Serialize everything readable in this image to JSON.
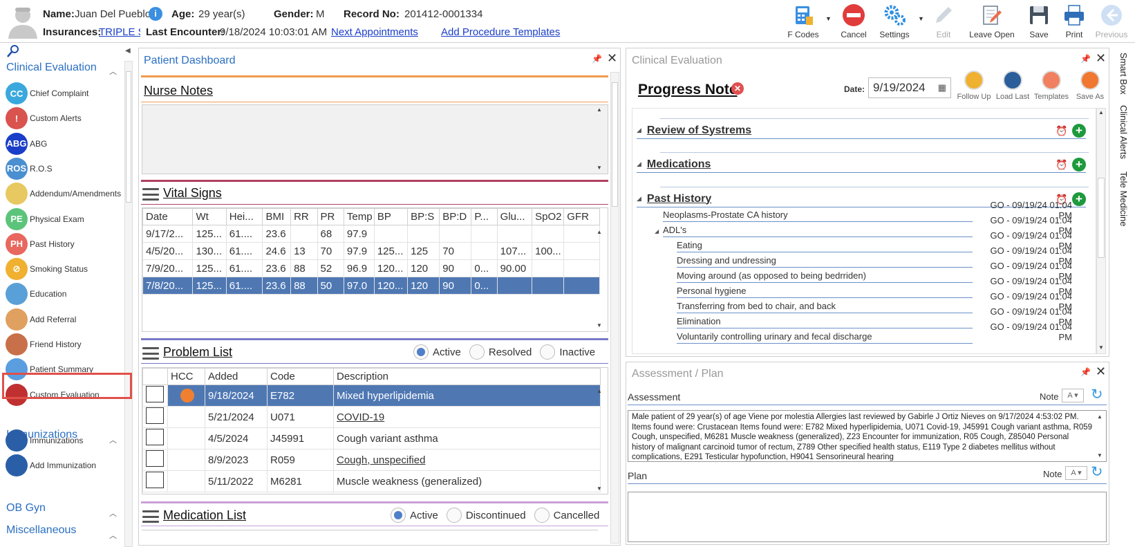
{
  "header": {
    "name_label": "Name:",
    "name_value": "Juan Del Pueblo",
    "age_label": "Age:",
    "age_value": "29 year(s)",
    "gender_label": "Gender:",
    "gender_value": "M",
    "record_label": "Record No:",
    "record_value": "201412-0001334",
    "insurances_label": "Insurances:",
    "insurances_value": "TRIPLE S",
    "last_encounter_label": "Last Encounter:",
    "last_encounter_value": "9/18/2024 10:03:01 AM",
    "next_appointments": "Next Appointments",
    "add_procedure_templates": "Add Procedure Templates"
  },
  "toolbar": {
    "fcodes": "F Codes",
    "cancel": "Cancel",
    "settings": "Settings",
    "edit": "Edit",
    "leave_open": "Leave Open",
    "save": "Save",
    "print": "Print",
    "previous": "Previous"
  },
  "nav": {
    "sections": {
      "clinical": "Clinical Evaluation",
      "immunizations": "Immunizations",
      "obgyn": "OB Gyn",
      "misc": "Miscellaneous"
    },
    "items": [
      {
        "label": "Chief Complaint",
        "badge": "CC",
        "color": "#3aa8dd"
      },
      {
        "label": "Custom Alerts",
        "badge": "!",
        "color": "#d9534f"
      },
      {
        "label": "ABG",
        "badge": "ABG",
        "color": "#1a3ec8"
      },
      {
        "label": "R.O.S",
        "badge": "ROS",
        "color": "#4a8fd0"
      },
      {
        "label": "Addendum/Amendments",
        "badge": "",
        "color": "#e8c860"
      },
      {
        "label": "Physical Exam",
        "badge": "PE",
        "color": "#5cc47a"
      },
      {
        "label": "Past History",
        "badge": "PH",
        "color": "#e8675f"
      },
      {
        "label": "Smoking Status",
        "badge": "⊘",
        "color": "#f0b030"
      },
      {
        "label": "Education",
        "badge": "",
        "color": "#5aa0d8"
      },
      {
        "label": "Add Referral",
        "badge": "",
        "color": "#e0a060"
      },
      {
        "label": "Friend History",
        "badge": "",
        "color": "#c8704a"
      },
      {
        "label": "Patient Summary",
        "badge": "",
        "color": "#5a9ee0"
      },
      {
        "label": "Custom Evaluation",
        "badge": "",
        "color": "#c03030"
      }
    ],
    "imm_items": [
      {
        "label": "Immunizations",
        "badge": "",
        "color": "#2a5fa8"
      },
      {
        "label": "Add Immunization",
        "badge": "",
        "color": "#2a5fa8"
      }
    ]
  },
  "dashboard": {
    "title": "Patient Dashboard",
    "nurse_notes": "Nurse Notes",
    "vital_signs": "Vital Signs",
    "vitals_columns": [
      "Date",
      "Wt",
      "Hei...",
      "BMI",
      "RR",
      "PR",
      "Temp",
      "BP",
      "BP:S",
      "BP:D",
      "P...",
      "Glu...",
      "SpO2",
      "GFR"
    ],
    "vitals_rows": [
      [
        "9/17/2...",
        "125...",
        "61....",
        "23.6",
        "",
        "68",
        "97.9",
        "",
        "",
        "",
        "",
        "",
        "",
        ""
      ],
      [
        "4/5/20...",
        "130...",
        "61....",
        "24.6",
        "13",
        "70",
        "97.9",
        "125...",
        "125",
        "70",
        "",
        "107...",
        "100...",
        ""
      ],
      [
        "7/9/20...",
        "125...",
        "61....",
        "23.6",
        "88",
        "52",
        "96.9",
        "120...",
        "120",
        "90",
        "0...",
        "90.00",
        "",
        ""
      ],
      [
        "7/8/20...",
        "125...",
        "61....",
        "23.6",
        "88",
        "50",
        "97.0",
        "120...",
        "120",
        "90",
        "0...",
        "",
        "",
        ""
      ]
    ],
    "problem_list": "Problem List",
    "problem_filters": [
      "Active",
      "Resolved",
      "Inactive"
    ],
    "problem_columns": [
      "HCC",
      "Added",
      "Code",
      "Description"
    ],
    "problem_rows": [
      {
        "added": "9/18/2024",
        "code": "E782",
        "desc": "Mixed hyperlipidemia",
        "link": false
      },
      {
        "added": "5/21/2024",
        "code": "U071",
        "desc": "COVID-19",
        "link": true
      },
      {
        "added": "4/5/2024",
        "code": "J45991",
        "desc": "Cough variant asthma",
        "link": false
      },
      {
        "added": "8/9/2023",
        "code": "R059",
        "desc": "Cough, unspecified",
        "link": true
      },
      {
        "added": "5/11/2022",
        "code": "M6281",
        "desc": "Muscle weakness (generalized)",
        "link": false
      }
    ],
    "medication_list": "Medication List",
    "medication_filters": [
      "Active",
      "Discontinued",
      "Cancelled"
    ]
  },
  "clinical": {
    "title": "Clinical Evaluation",
    "progress_note": "Progress Note",
    "date_label": "Date:",
    "date_value": "9/19/2024",
    "actions": [
      "Follow Up",
      "Load Last",
      "Templates",
      "Save As"
    ],
    "sections": [
      "Review of Systrems",
      "Medications",
      "Past History"
    ],
    "entries": [
      {
        "label": "Neoplasms-Prostate CA history",
        "meta": "GO - 09/19/24 01:04 PM",
        "indent": 0
      },
      {
        "label": "ADL's",
        "meta": "GO - 09/19/24 01:04 PM",
        "indent": 0
      },
      {
        "label": "Eating",
        "meta": "GO - 09/19/24 01:04 PM",
        "indent": 1
      },
      {
        "label": "Dressing and undressing",
        "meta": "GO - 09/19/24 01:04 PM",
        "indent": 1
      },
      {
        "label": "Moving around (as opposed to being bedrriden)",
        "meta": "GO - 09/19/24 01:04 PM",
        "indent": 1
      },
      {
        "label": "Personal hygiene",
        "meta": "GO - 09/19/24 01:04 PM",
        "indent": 1
      },
      {
        "label": "Transferring from bed to chair, and back",
        "meta": "GO - 09/19/24 01:04 PM",
        "indent": 1
      },
      {
        "label": "Elimination",
        "meta": "GO - 09/19/24 01:04 PM",
        "indent": 1
      },
      {
        "label": "Voluntarily controlling urinary and fecal discharge",
        "meta": "GO - 09/19/24 01:04 PM",
        "indent": 1
      }
    ]
  },
  "assessment": {
    "title": "Assessment / Plan",
    "assessment_label": "Assessment",
    "note_label": "Note",
    "text": "Male patient of 29 year(s) of age Viene por molestia     Allergies last reviewed by Gabirle J Ortiz Nieves on 9/17/2024 4:53:02 PM.    Items found were:  Crustacean  Items found were:  E782 Mixed hyperlipidemia, U071 Covid-19, J45991 Cough variant asthma, R059 Cough, unspecified, M6281 Muscle weakness (generalized), Z23 Encounter for immunization, R05 Cough, Z85040 Personal history of malignant carcinoid tumor of rectum, Z789 Other specified health status, E119 Type 2 diabetes mellitus without complications, E291 Testicular hypofunction, H9041 Sensorineural hearing",
    "plan_label": "Plan",
    "plan_note_label": "Note"
  },
  "side_tabs": [
    "Smart Box",
    "Clinical Alerts",
    "Tele Medicine"
  ],
  "colors": {
    "accent": "#2a6fc2",
    "selected_row": "#4f78b3",
    "highlight_border": "#e0504a",
    "arrow": "#e8574f"
  }
}
